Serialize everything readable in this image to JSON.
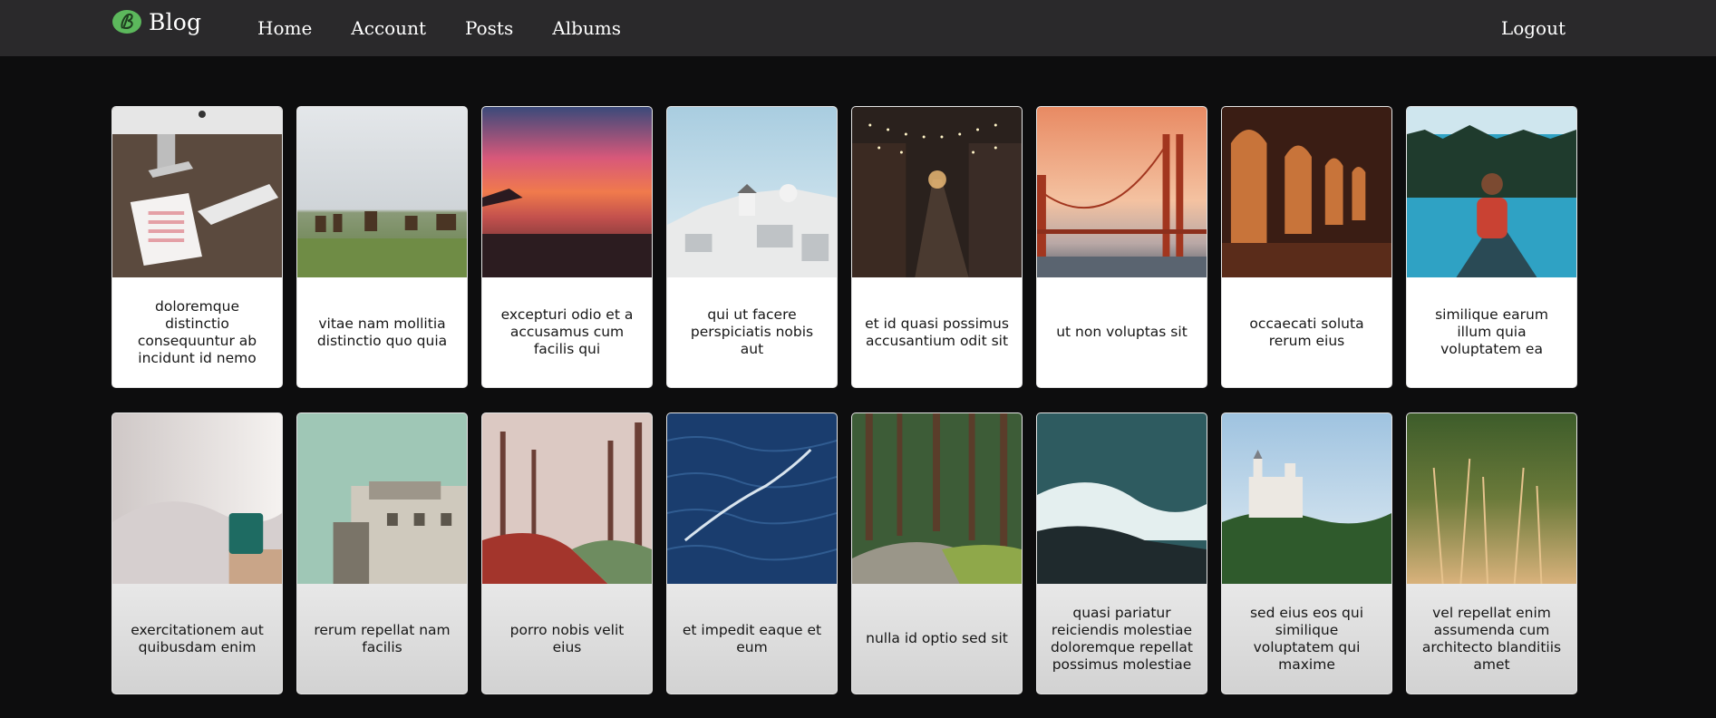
{
  "app": {
    "brand": "Blog",
    "logo_icon": "blog-logo-icon",
    "accent": "#5cb85c"
  },
  "nav": {
    "items": [
      {
        "label": "Home"
      },
      {
        "label": "Account"
      },
      {
        "label": "Posts"
      },
      {
        "label": "Albums"
      }
    ],
    "logout": "Logout"
  },
  "photos": [
    {
      "title": "doloremque distinctio consequuntur ab incidunt id nemo",
      "image": "desk-computer-calendar-photo"
    },
    {
      "title": "vitae nam mollitia distinctio quo quia",
      "image": "horses-in-field-photo"
    },
    {
      "title": "excepturi odio et a accusamus cum facilis qui",
      "image": "sunset-beach-photo"
    },
    {
      "title": "qui ut facere perspiciatis nobis aut",
      "image": "santorini-windmill-photo"
    },
    {
      "title": "et id quasi possimus accusantium odit sit",
      "image": "night-street-lights-photo"
    },
    {
      "title": "ut non voluptas sit",
      "image": "golden-gate-bridge-photo"
    },
    {
      "title": "occaecati soluta rerum eius",
      "image": "arched-cloister-photo"
    },
    {
      "title": "similique earum illum quia voluptatem ea",
      "image": "woman-in-canoe-photo"
    },
    {
      "title": "exercitationem aut quibusdam enim",
      "image": "bed-with-mug-photo"
    },
    {
      "title": "rerum repellat nam facilis",
      "image": "old-bunker-building-photo"
    },
    {
      "title": "porro nobis velit eius",
      "image": "misty-forest-path-photo"
    },
    {
      "title": "et impedit eaque et eum",
      "image": "blue-ocean-water-photo"
    },
    {
      "title": "nulla id optio sed sit",
      "image": "forest-road-photo"
    },
    {
      "title": "quasi pariatur reiciendis molestiae doloremque repellat possimus molestiae",
      "image": "rocky-sea-waves-photo"
    },
    {
      "title": "sed eius eos qui similique voluptatem qui maxime",
      "image": "castle-on-hill-photo"
    },
    {
      "title": "vel repellat enim assumenda cum architecto blanditiis amet",
      "image": "dry-grass-photo"
    }
  ]
}
